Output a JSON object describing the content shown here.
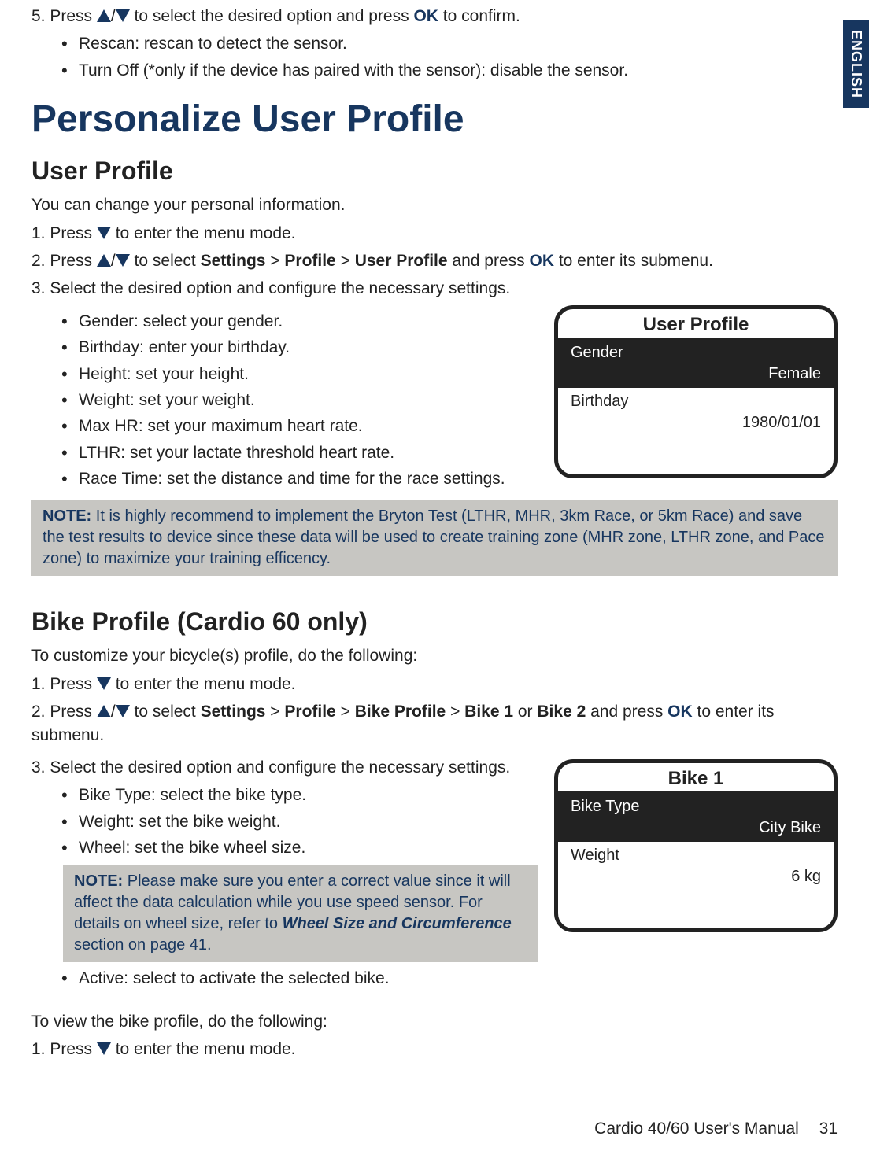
{
  "side_tab": "ENGLISH",
  "intro_step5": {
    "prefix": "5. Press ",
    "mid": " to select the desired option and press ",
    "ok": "OK",
    "suffix": " to confirm.",
    "bullets": {
      "rescan": "Rescan: rescan to detect the sensor.",
      "turnoff": "Turn Off (*only if the device has paired with the sensor): disable the sensor."
    }
  },
  "main_title": "Personalize User Profile",
  "user_profile": {
    "heading": "User Profile",
    "intro": "You can change your personal information.",
    "step1_prefix": "1. Press ",
    "step1_suffix": " to enter the menu mode.",
    "step2": {
      "prefix": "2. Press ",
      "sel": " to select ",
      "p1": "Settings",
      "gt1": " > ",
      "p2": "Profile",
      "gt2": " > ",
      "p3": "User Profile",
      "and": " and press ",
      "ok": "OK",
      "suffix": " to enter its submenu."
    },
    "step3": "3. Select the desired option and configure the necessary settings.",
    "bullets": {
      "gender": "Gender: select your gender.",
      "birthday": "Birthday: enter your birthday.",
      "height": "Height: set your height.",
      "weight": "Weight: set your weight.",
      "maxhr": "Max HR: set your maximum heart rate.",
      "lthr": "LTHR: set your lactate threshold heart rate.",
      "race": "Race Time: set the distance and time for the race settings."
    },
    "note_label": "NOTE:",
    "note_text": " It is  highly recommend to implement the Bryton Test (LTHR, MHR, 3km Race, or 5km Race) and save the test results to device since these data will be used to create training zone (MHR zone, LTHR zone, and Pace zone) to maximize your training efficency.",
    "device": {
      "title": "User Profile",
      "row1_label": "Gender",
      "row1_value": "Female",
      "row2_label": "Birthday",
      "row2_value": "1980/01/01"
    }
  },
  "bike_profile": {
    "heading": "Bike Profile (Cardio 60 only)",
    "intro": "To customize your bicycle(s) profile, do the following:",
    "step1_prefix": "1. Press ",
    "step1_suffix": " to enter the menu mode.",
    "step2": {
      "prefix": "2. Press ",
      "sel": " to select ",
      "p1": "Settings",
      "gt1": " > ",
      "p2": "Profile",
      "gt2": " > ",
      "p3": "Bike Profile",
      "gt3": " > ",
      "p4": "Bike 1",
      "or": " or ",
      "p5": "Bike 2",
      "and": " and press ",
      "ok": "OK",
      "suffix": " to enter its submenu."
    },
    "step3": "3. Select the desired option and configure the necessary settings.",
    "bullets": {
      "type": "Bike Type: select the bike type.",
      "weight": "Weight: set the bike weight.",
      "wheel": "Wheel: set the bike wheel size.",
      "active": "Active: select to activate the selected bike."
    },
    "note_label": "NOTE:",
    "note_text1": " Please make sure you enter a correct value since it will affect the data calculation while you use speed sensor. For details on wheel size, refer to ",
    "note_link": "Wheel Size and Circumference",
    "note_text2": " section on page 41.",
    "view_intro": "To view the bike profile, do the following:",
    "view_step1_prefix": "1. Press ",
    "view_step1_suffix": " to enter the menu mode.",
    "device": {
      "title": "Bike 1",
      "row1_label": "Bike Type",
      "row1_value": "City Bike",
      "row2_label": "Weight",
      "row2_value": "6 kg"
    }
  },
  "footer": {
    "manual": "Cardio 40/60 User's Manual",
    "page": "31"
  }
}
